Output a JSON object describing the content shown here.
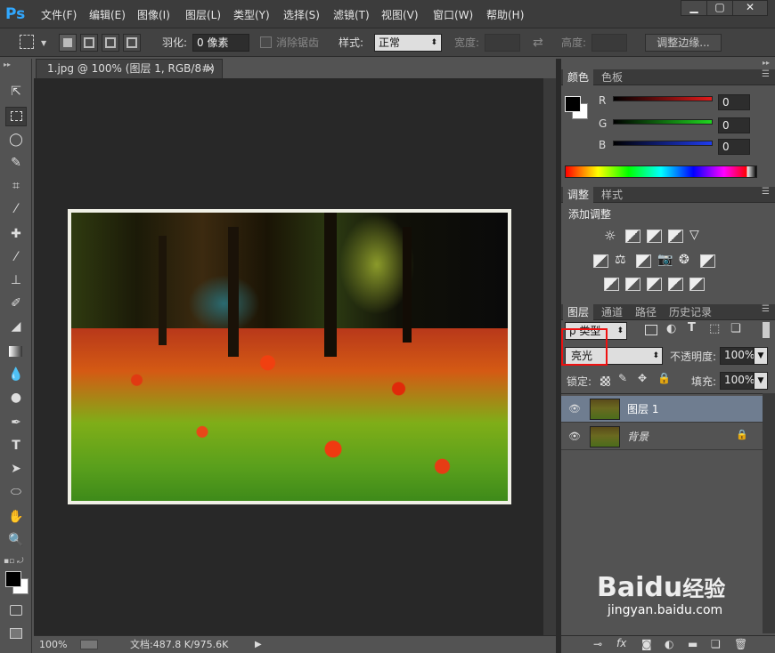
{
  "app": {
    "logo": "Ps",
    "accent": "#31a8ff"
  },
  "menu": [
    "文件(F)",
    "编辑(E)",
    "图像(I)",
    "图层(L)",
    "类型(Y)",
    "选择(S)",
    "滤镜(T)",
    "视图(V)",
    "窗口(W)",
    "帮助(H)"
  ],
  "window_controls": {
    "minimize": "▁",
    "maximize": "▢",
    "close": "✕"
  },
  "options": {
    "feather_label": "羽化:",
    "feather_value": "0 像素",
    "antialias_label": "消除锯齿",
    "style_label": "样式:",
    "style_value": "正常",
    "width_label": "宽度:",
    "height_label": "高度:",
    "refine_edge": "调整边缘..."
  },
  "document": {
    "tab": "1.jpg @ 100% (图层 1, RGB/8#) *",
    "close": "×"
  },
  "status": {
    "zoom": "100%",
    "doc_info": "文档:487.8 K/975.6K"
  },
  "color_panel": {
    "tabs": [
      "颜色",
      "色板"
    ],
    "channels": [
      {
        "label": "R",
        "value": "0",
        "color": "#e21b1b"
      },
      {
        "label": "G",
        "value": "0",
        "color": "#1fd61f"
      },
      {
        "label": "B",
        "value": "0",
        "color": "#1f3cf0"
      }
    ]
  },
  "adjust_panel": {
    "tabs": [
      "调整",
      "样式"
    ],
    "title": "添加调整"
  },
  "layers_panel": {
    "tabs": [
      "图层",
      "通道",
      "路径",
      "历史记录"
    ],
    "filter_kind": "ρ 类型",
    "blend_mode": "亮光",
    "opacity_label": "不透明度:",
    "opacity_value": "100%",
    "lock_label": "锁定:",
    "fill_label": "填充:",
    "fill_value": "100%",
    "layers": [
      {
        "name": "图层 1",
        "selected": true
      },
      {
        "name": "背景",
        "locked": true
      }
    ]
  },
  "watermark": {
    "brand": "Baidu",
    "product": "经验",
    "url": "jingyan.baidu.com"
  }
}
